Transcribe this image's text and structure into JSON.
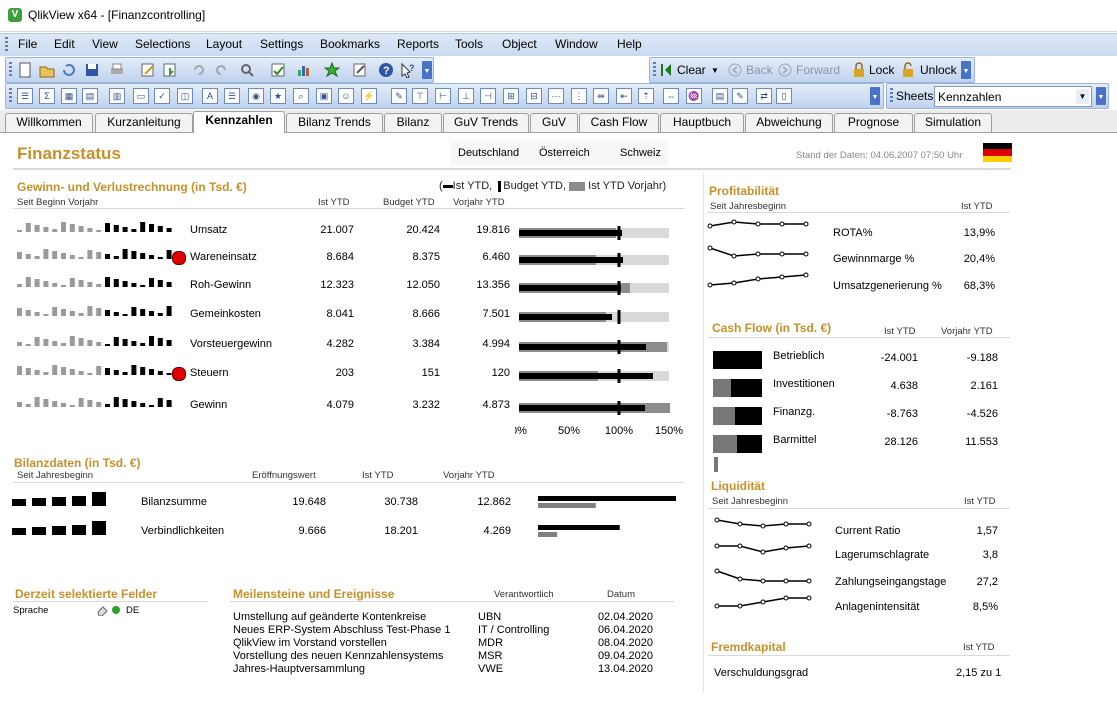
{
  "window": {
    "title": "QlikView x64 - [Finanzcontrolling]"
  },
  "menu": [
    "File",
    "Edit",
    "View",
    "Selections",
    "Layout",
    "Settings",
    "Bookmarks",
    "Reports",
    "Tools",
    "Object",
    "Window",
    "Help"
  ],
  "toolbar": {
    "clear": "Clear",
    "back": "Back",
    "forward": "Forward",
    "lock": "Lock",
    "unlock": "Unlock",
    "sheets_label": "Sheets",
    "sheets_value": "Kennzahlen"
  },
  "tabs": [
    "Willkommen",
    "Kurzanleitung",
    "Kennzahlen",
    "Bilanz Trends",
    "Bilanz",
    "GuV Trends",
    "GuV",
    "Cash Flow",
    "Hauptbuch",
    "Abweichung",
    "Prognose",
    "Simulation"
  ],
  "active_tab": "Kennzahlen",
  "header": {
    "title": "Finanzstatus",
    "countries": [
      "Deutschland",
      "Österreich",
      "Schweiz"
    ],
    "stand": "Stand der Daten: 04.06.2007 07:50 Uhr"
  },
  "guv": {
    "title": "Gewinn- und Verlustrechnung (in Tsd. €)",
    "legend": {
      "ist": "Ist YTD,",
      "budget": "Budget YTD,",
      "vorjahr": "Ist YTD Vorjahr)"
    },
    "subheader": "Seit Beginn Vorjahr",
    "columns": [
      "Ist YTD",
      "Budget YTD",
      "Vorjahr YTD"
    ],
    "axis": [
      "0%",
      "50%",
      "100%",
      "150%"
    ],
    "rows": [
      {
        "name": "Umsatz",
        "ist": "21.007",
        "budget": "20.424",
        "vorjahr": "19.816",
        "alert": false,
        "ist_pct": 103,
        "budget_pct": 100,
        "vorjahr_pct": 97
      },
      {
        "name": "Wareneinsatz",
        "ist": "8.684",
        "budget": "8.375",
        "vorjahr": "6.460",
        "alert": true,
        "ist_pct": 104,
        "budget_pct": 100,
        "vorjahr_pct": 77
      },
      {
        "name": "Roh-Gewinn",
        "ist": "12.323",
        "budget": "12.050",
        "vorjahr": "13.356",
        "alert": false,
        "ist_pct": 102,
        "budget_pct": 100,
        "vorjahr_pct": 111
      },
      {
        "name": "Gemeinkosten",
        "ist": "8.041",
        "budget": "8.666",
        "vorjahr": "7.501",
        "alert": false,
        "ist_pct": 93,
        "budget_pct": 100,
        "vorjahr_pct": 87
      },
      {
        "name": "Vorsteuergewinn",
        "ist": "4.282",
        "budget": "3.384",
        "vorjahr": "4.994",
        "alert": false,
        "ist_pct": 127,
        "budget_pct": 100,
        "vorjahr_pct": 148
      },
      {
        "name": "Steuern",
        "ist": "203",
        "budget": "151",
        "vorjahr": "120",
        "alert": true,
        "ist_pct": 134,
        "budget_pct": 100,
        "vorjahr_pct": 79
      },
      {
        "name": "Gewinn",
        "ist": "4.079",
        "budget": "3.232",
        "vorjahr": "4.873",
        "alert": false,
        "ist_pct": 126,
        "budget_pct": 100,
        "vorjahr_pct": 151
      }
    ]
  },
  "bilanz": {
    "title": "Bilanzdaten (in Tsd. €)",
    "subheader": "Seit Jahresbeginn",
    "columns": [
      "Eröffnungswert",
      "Ist YTD",
      "Vorjahr YTD"
    ],
    "rows": [
      {
        "name": "Bilanzsumme",
        "eroeffnung": "19.648",
        "ist": "30.738",
        "vorjahr": "12.862"
      },
      {
        "name": "Verbindlichkeiten",
        "eroeffnung": "9.666",
        "ist": "18.201",
        "vorjahr": "4.269"
      }
    ]
  },
  "felder": {
    "title": "Derzeit selektierte Felder",
    "field": "Sprache",
    "value": "DE"
  },
  "meilensteine": {
    "title": "Meilensteine und Ereignisse",
    "columns": [
      "Verantwortlich",
      "Datum"
    ],
    "rows": [
      {
        "text": "Umstellung auf geänderte Kontenkreise",
        "who": "UBN",
        "date": "02.04.2020"
      },
      {
        "text": "Neues ERP-System Abschluss Test-Phase 1",
        "who": "IT / Controlling",
        "date": "06.04.2020"
      },
      {
        "text": "QlikView im Vorstand vorstellen",
        "who": "MDR",
        "date": "08.04.2020"
      },
      {
        "text": "Vorstellung des neuen Kennzahlensystems",
        "who": "MSR",
        "date": "09.04.2020"
      },
      {
        "text": "Jahres-Hauptversammlung",
        "who": "VWE",
        "date": "13.04.2020"
      }
    ]
  },
  "profitabilitaet": {
    "title": "Profitabilität",
    "subheader": "Seit Jahresbeginn",
    "column": "Ist YTD",
    "rows": [
      {
        "name": "ROTA%",
        "value": "13,9%"
      },
      {
        "name": "Gewinnmarge %",
        "value": "20,4%"
      },
      {
        "name": "Umsatzgenerierung %",
        "value": "68,3%"
      }
    ]
  },
  "cashflow": {
    "title": "Cash Flow (in Tsd. €)",
    "columns": [
      "Ist YTD",
      "Vorjahr YTD"
    ],
    "rows": [
      {
        "name": "Betrieblich",
        "ist": "-24.001",
        "vorjahr": "-9.188"
      },
      {
        "name": "Investitionen",
        "ist": "4.638",
        "vorjahr": "2.161"
      },
      {
        "name": "Finanzg.",
        "ist": "-8.763",
        "vorjahr": "-4.526"
      },
      {
        "name": "Barmittel",
        "ist": "28.126",
        "vorjahr": "11.553"
      }
    ]
  },
  "liquiditaet": {
    "title": "Liquidität",
    "subheader": "Seit Jahresbeginn",
    "column": "Ist YTD",
    "rows": [
      {
        "name": "Current Ratio",
        "value": "1,57"
      },
      {
        "name": "Lagerumschlagrate",
        "value": "3,8"
      },
      {
        "name": "Zahlungseingangstage",
        "value": "27,2"
      },
      {
        "name": "Anlagenintensität",
        "value": "8,5%"
      }
    ]
  },
  "fremdkapital": {
    "title": "Fremdkapital",
    "column": "Ist YTD",
    "row": {
      "name": "Verschuldungsgrad",
      "value": "2,15 zu 1"
    }
  },
  "colors": {
    "gold": "#c8902a",
    "alert": "#e00000",
    "bar_dark": "#000000",
    "bar_grey": "#808080",
    "bar_light": "#d9d9d9"
  }
}
